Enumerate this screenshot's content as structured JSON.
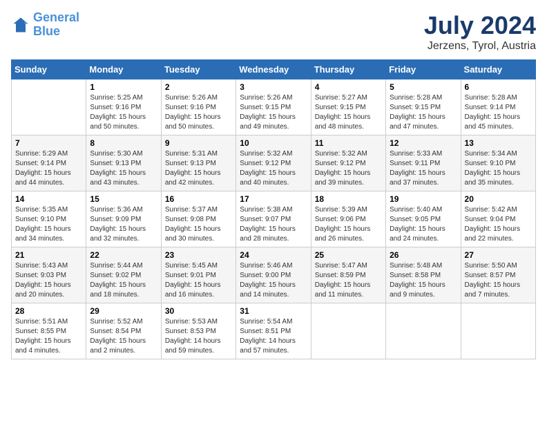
{
  "header": {
    "logo_line1": "General",
    "logo_line2": "Blue",
    "month_year": "July 2024",
    "location": "Jerzens, Tyrol, Austria"
  },
  "weekdays": [
    "Sunday",
    "Monday",
    "Tuesday",
    "Wednesday",
    "Thursday",
    "Friday",
    "Saturday"
  ],
  "weeks": [
    [
      {
        "day": "",
        "detail": ""
      },
      {
        "day": "1",
        "detail": "Sunrise: 5:25 AM\nSunset: 9:16 PM\nDaylight: 15 hours\nand 50 minutes."
      },
      {
        "day": "2",
        "detail": "Sunrise: 5:26 AM\nSunset: 9:16 PM\nDaylight: 15 hours\nand 50 minutes."
      },
      {
        "day": "3",
        "detail": "Sunrise: 5:26 AM\nSunset: 9:15 PM\nDaylight: 15 hours\nand 49 minutes."
      },
      {
        "day": "4",
        "detail": "Sunrise: 5:27 AM\nSunset: 9:15 PM\nDaylight: 15 hours\nand 48 minutes."
      },
      {
        "day": "5",
        "detail": "Sunrise: 5:28 AM\nSunset: 9:15 PM\nDaylight: 15 hours\nand 47 minutes."
      },
      {
        "day": "6",
        "detail": "Sunrise: 5:28 AM\nSunset: 9:14 PM\nDaylight: 15 hours\nand 45 minutes."
      }
    ],
    [
      {
        "day": "7",
        "detail": "Sunrise: 5:29 AM\nSunset: 9:14 PM\nDaylight: 15 hours\nand 44 minutes."
      },
      {
        "day": "8",
        "detail": "Sunrise: 5:30 AM\nSunset: 9:13 PM\nDaylight: 15 hours\nand 43 minutes."
      },
      {
        "day": "9",
        "detail": "Sunrise: 5:31 AM\nSunset: 9:13 PM\nDaylight: 15 hours\nand 42 minutes."
      },
      {
        "day": "10",
        "detail": "Sunrise: 5:32 AM\nSunset: 9:12 PM\nDaylight: 15 hours\nand 40 minutes."
      },
      {
        "day": "11",
        "detail": "Sunrise: 5:32 AM\nSunset: 9:12 PM\nDaylight: 15 hours\nand 39 minutes."
      },
      {
        "day": "12",
        "detail": "Sunrise: 5:33 AM\nSunset: 9:11 PM\nDaylight: 15 hours\nand 37 minutes."
      },
      {
        "day": "13",
        "detail": "Sunrise: 5:34 AM\nSunset: 9:10 PM\nDaylight: 15 hours\nand 35 minutes."
      }
    ],
    [
      {
        "day": "14",
        "detail": "Sunrise: 5:35 AM\nSunset: 9:10 PM\nDaylight: 15 hours\nand 34 minutes."
      },
      {
        "day": "15",
        "detail": "Sunrise: 5:36 AM\nSunset: 9:09 PM\nDaylight: 15 hours\nand 32 minutes."
      },
      {
        "day": "16",
        "detail": "Sunrise: 5:37 AM\nSunset: 9:08 PM\nDaylight: 15 hours\nand 30 minutes."
      },
      {
        "day": "17",
        "detail": "Sunrise: 5:38 AM\nSunset: 9:07 PM\nDaylight: 15 hours\nand 28 minutes."
      },
      {
        "day": "18",
        "detail": "Sunrise: 5:39 AM\nSunset: 9:06 PM\nDaylight: 15 hours\nand 26 minutes."
      },
      {
        "day": "19",
        "detail": "Sunrise: 5:40 AM\nSunset: 9:05 PM\nDaylight: 15 hours\nand 24 minutes."
      },
      {
        "day": "20",
        "detail": "Sunrise: 5:42 AM\nSunset: 9:04 PM\nDaylight: 15 hours\nand 22 minutes."
      }
    ],
    [
      {
        "day": "21",
        "detail": "Sunrise: 5:43 AM\nSunset: 9:03 PM\nDaylight: 15 hours\nand 20 minutes."
      },
      {
        "day": "22",
        "detail": "Sunrise: 5:44 AM\nSunset: 9:02 PM\nDaylight: 15 hours\nand 18 minutes."
      },
      {
        "day": "23",
        "detail": "Sunrise: 5:45 AM\nSunset: 9:01 PM\nDaylight: 15 hours\nand 16 minutes."
      },
      {
        "day": "24",
        "detail": "Sunrise: 5:46 AM\nSunset: 9:00 PM\nDaylight: 15 hours\nand 14 minutes."
      },
      {
        "day": "25",
        "detail": "Sunrise: 5:47 AM\nSunset: 8:59 PM\nDaylight: 15 hours\nand 11 minutes."
      },
      {
        "day": "26",
        "detail": "Sunrise: 5:48 AM\nSunset: 8:58 PM\nDaylight: 15 hours\nand 9 minutes."
      },
      {
        "day": "27",
        "detail": "Sunrise: 5:50 AM\nSunset: 8:57 PM\nDaylight: 15 hours\nand 7 minutes."
      }
    ],
    [
      {
        "day": "28",
        "detail": "Sunrise: 5:51 AM\nSunset: 8:55 PM\nDaylight: 15 hours\nand 4 minutes."
      },
      {
        "day": "29",
        "detail": "Sunrise: 5:52 AM\nSunset: 8:54 PM\nDaylight: 15 hours\nand 2 minutes."
      },
      {
        "day": "30",
        "detail": "Sunrise: 5:53 AM\nSunset: 8:53 PM\nDaylight: 14 hours\nand 59 minutes."
      },
      {
        "day": "31",
        "detail": "Sunrise: 5:54 AM\nSunset: 8:51 PM\nDaylight: 14 hours\nand 57 minutes."
      },
      {
        "day": "",
        "detail": ""
      },
      {
        "day": "",
        "detail": ""
      },
      {
        "day": "",
        "detail": ""
      }
    ]
  ]
}
